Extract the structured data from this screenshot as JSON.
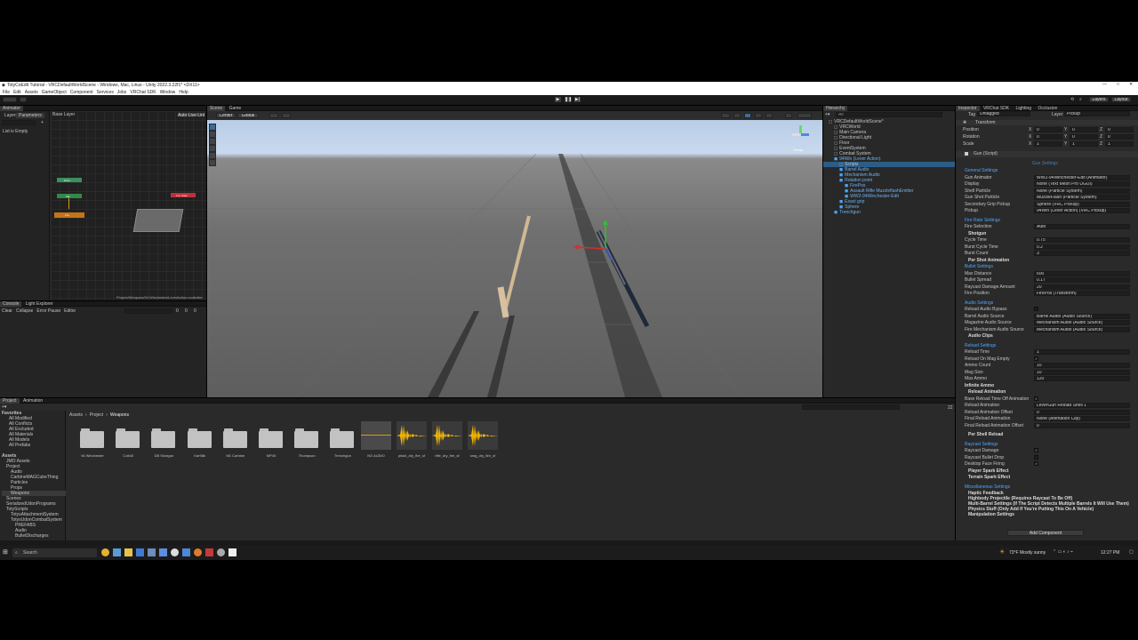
{
  "window_title": "TotyCoEdit Tutorial - VRCDefaultWorldScene - Windows, Mac, Linux - Unity 2022.3.22f1* <DX11>",
  "menu": [
    "File",
    "Edit",
    "Assets",
    "GameObject",
    "Component",
    "Services",
    "Jobs",
    "VRChat SDK",
    "Window",
    "Help"
  ],
  "toolbar": {
    "layers": "Layers",
    "layout": "Layout"
  },
  "animator": {
    "tab": "Animator",
    "subtabs": [
      "Layers",
      "Parameters"
    ],
    "base_layer": "Base Layer",
    "auto_live_link": "Auto Live Link",
    "search_placeholder": "Name",
    "empty_text": "List is Empty",
    "path": "Project/Weapons/94 Winchester/LeverAction.controller"
  },
  "console": {
    "tabs": [
      "Console",
      "Light Explorer"
    ],
    "buttons": [
      "Clear",
      "Collapse",
      "Error Pause",
      "Editor"
    ],
    "counts": [
      "0",
      "0",
      "0"
    ]
  },
  "scene": {
    "tabs": [
      "Scene",
      "Game"
    ],
    "pivot": "Center",
    "space": "Global",
    "persp": "Persp"
  },
  "hierarchy": {
    "tab": "Hierarchy",
    "search_placeholder": "All",
    "items": [
      {
        "label": "VRCDefaultWorldScene*",
        "depth": 0,
        "selected": false,
        "blue": false
      },
      {
        "label": "VRCWorld",
        "depth": 1,
        "selected": false,
        "blue": false
      },
      {
        "label": "Main Camera",
        "depth": 1,
        "selected": false,
        "blue": false
      },
      {
        "label": "Directional Light",
        "depth": 1,
        "selected": false,
        "blue": false
      },
      {
        "label": "Floor",
        "depth": 1,
        "selected": false,
        "blue": false
      },
      {
        "label": "EventSystem",
        "depth": 1,
        "selected": false,
        "blue": false
      },
      {
        "label": "Combat System",
        "depth": 1,
        "selected": false,
        "blue": false
      },
      {
        "label": "94Win (Lever Action)",
        "depth": 1,
        "selected": false,
        "blue": true
      },
      {
        "label": "Scripts",
        "depth": 2,
        "selected": true,
        "blue": false
      },
      {
        "label": "Barrel Audio",
        "depth": 2,
        "selected": false,
        "blue": true
      },
      {
        "label": "Mechanism Audio",
        "depth": 2,
        "selected": false,
        "blue": true
      },
      {
        "label": "Rotation point",
        "depth": 2,
        "selected": false,
        "blue": true
      },
      {
        "label": "FirePos",
        "depth": 3,
        "selected": false,
        "blue": true
      },
      {
        "label": "Assault Rifle MuzzleflashEmitter",
        "depth": 3,
        "selected": false,
        "blue": true
      },
      {
        "label": "WW2-94Winchester-Edit",
        "depth": 3,
        "selected": false,
        "blue": true
      },
      {
        "label": "Exact grip",
        "depth": 2,
        "selected": false,
        "blue": true
      },
      {
        "label": "Sphere",
        "depth": 2,
        "selected": false,
        "blue": true
      },
      {
        "label": "Trenchgun",
        "depth": 1,
        "selected": false,
        "blue": true
      }
    ]
  },
  "inspector": {
    "tabs": [
      "Inspector",
      "VRChat SDK",
      "Lighting",
      "Occlusion"
    ],
    "tag_label": "Tag",
    "tag_value": "Untagged",
    "layer_label": "Layer",
    "layer_value": "Pickup",
    "transform_title": "Transform",
    "transform_rows": [
      {
        "label": "Position",
        "x": "0",
        "y": "0",
        "z": "0"
      },
      {
        "label": "Rotation",
        "x": "0",
        "y": "0",
        "z": "0"
      },
      {
        "label": "Scale",
        "x": "1",
        "y": "1",
        "z": "1"
      }
    ],
    "script_title": "Gun (Script)",
    "gun_settings_header": "Gun Settings",
    "general_title": "General Settings",
    "general_rows": [
      {
        "label": "Gun Animator",
        "value": "WW2-94Winchester-Edit (Animator)"
      },
      {
        "label": "Display",
        "value": "None (Text Mesh Pro UGUI)"
      },
      {
        "label": "Shell Particle",
        "value": "None (Particle System)"
      },
      {
        "label": "Gun Shot Particle",
        "value": "MuzzleFlash (Particle System)"
      },
      {
        "label": "Secondary Grip Pickup",
        "value": "Sphere (VRC Pickup)"
      },
      {
        "label": "Pickup",
        "value": "94Win (Lever Action) (VRC Pickup)"
      }
    ],
    "fire_rate_title": "Fire Rate Settings",
    "fire_selection_label": "Fire Selection",
    "fire_selection_value": "Auto",
    "shotgun_label": "Shotgun",
    "fire_rate_rows": [
      {
        "label": "Cycle Time",
        "value": "0.75"
      },
      {
        "label": "Burst Cycle Time",
        "value": "0.2"
      },
      {
        "label": "Burst Count",
        "value": "3"
      }
    ],
    "per_shot_anim": "Per Shot Animation",
    "bullet_title": "Bullet Settings",
    "bullet_rows": [
      {
        "label": "Max Distance",
        "value": "600"
      },
      {
        "label": "Bullet Spread",
        "value": "0.17"
      },
      {
        "label": "Raycast Damage Amount",
        "value": "20"
      },
      {
        "label": "Fire Position",
        "value": "FirePos (Transform)"
      }
    ],
    "audio_title": "Audio Settings",
    "audio_bypass_label": "Reload Audio Bypass",
    "audio_rows": [
      {
        "label": "Barrel Audio Source",
        "value": "Barrel Audio (Audio Source)"
      },
      {
        "label": "Magazine Audio Source",
        "value": "Mechanism Audio (Audio Source)"
      },
      {
        "label": "Fire Mechanism Audio Source",
        "value": "Mechanism Audio (Audio Source)"
      }
    ],
    "audio_clips": "Audio Clips",
    "reload_title": "Reload Settings",
    "reload_rows": [
      {
        "label": "Reload Time",
        "value": "1"
      },
      {
        "label": "Reload On Mag Empty",
        "value": "✓"
      },
      {
        "label": "Ammo Count",
        "value": "10"
      },
      {
        "label": "Mag Size",
        "value": "10"
      },
      {
        "label": "Max Ammo",
        "value": "120"
      }
    ],
    "infinite_ammo": "Infinite Ammo",
    "reload_animation": "Reload Animation",
    "reload_anim_rows": [
      {
        "label": "Base Reload Time Off Animation",
        "value": "✓"
      },
      {
        "label": "Reload Animation",
        "value": "LeverGun Reload Shell 1"
      },
      {
        "label": "Reload Animation Offset",
        "value": "0"
      },
      {
        "label": "Final Reload Animation",
        "value": "None (Animation Clip)"
      },
      {
        "label": "Final Reload Animation Offset",
        "value": "0"
      }
    ],
    "per_shell_reload": "Per Shell Reload",
    "raycast_title": "Raycast Settings",
    "raycast_rows": [
      {
        "label": "Raycast Damage",
        "value": "✓"
      },
      {
        "label": "Raycast Bullet Drop",
        "value": ""
      },
      {
        "label": "Desktop Face Firing",
        "value": "✓"
      }
    ],
    "player_spark": "Player Spark Effect",
    "terrain_spark": "Terrain Spark Effect",
    "misc_title": "Miscellaneous Settings",
    "misc_rows": [
      "Haptic Feedback",
      "Highbody Projectile (Requires Raycast To Be Off)",
      "Multi-Barrel Settings (If The Script Detects Multiple Barrels It Will Use Them)",
      "Physics Stuff (Only Add If You're Putting This On A Vehicle)",
      "Manipulation Settings"
    ],
    "add_component": "Add Component"
  },
  "project": {
    "tabs": [
      "Project",
      "Animation"
    ],
    "breadcrumb": [
      "Assets",
      "Project",
      "Weapons"
    ],
    "favorites_title": "Favorites",
    "favorites": [
      "All Modified",
      "All Conflicts",
      "All Excluded",
      "All Materials",
      "All Models",
      "All Prefabs"
    ],
    "assets_title": "Assets",
    "tree": [
      "JMO Assets",
      "Project",
      "Audio",
      "CarbineMAGCubeThing",
      "Particles",
      "Props",
      "Weapons",
      "Scenes",
      "SerializedUdonPrograms",
      "TotyScripts",
      "TotysAttachmentSystem",
      "TotysUdonCombatSystem",
      "PREFABS",
      "Audio",
      "BulletDischarges"
    ],
    "folders": [
      "94 Winchester",
      "Colt45",
      "DB Shotgun",
      "Kar98k",
      "M1 Carbine",
      "MP40",
      "Thompson",
      "Trenchgun"
    ],
    "audio_files": [
      "NO AUDIO",
      "pistol_dry_fire_sf",
      "rifle_dry_fire_sf",
      "smg_dry_fire_sf"
    ],
    "count": "22"
  },
  "taskbar": {
    "search": "Search",
    "weather": "73°F  Mostly sunny",
    "time": "12:27 PM"
  },
  "animator_nodes": [
    {
      "label": "Entry",
      "color": "#3a8f5c"
    },
    {
      "label": "Idle",
      "color": "#2f8a4a"
    },
    {
      "label": "Any State",
      "color": "#c0303a"
    },
    {
      "label": "Fire",
      "color": "#c47418"
    }
  ]
}
